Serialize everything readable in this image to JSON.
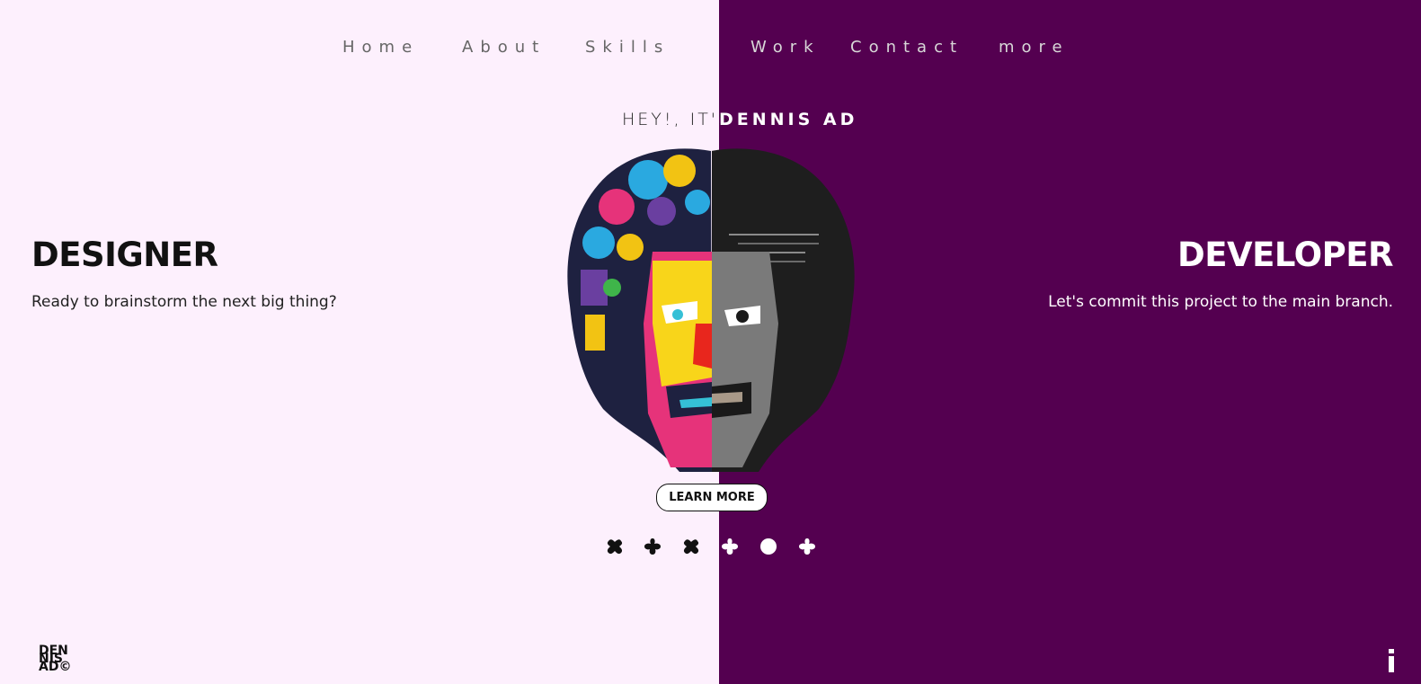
{
  "nav": {
    "items": [
      {
        "label": "Home",
        "theme": "light"
      },
      {
        "label": "About",
        "theme": "light"
      },
      {
        "label": "Skills",
        "theme": "light"
      },
      {
        "label": "Work",
        "theme": "dark"
      },
      {
        "label": "Contact",
        "theme": "dark"
      },
      {
        "label": "more",
        "theme": "dark"
      }
    ]
  },
  "hero": {
    "greeting": "HEY!, IT'S",
    "name": "DENNIS AD",
    "left_title": "DESIGNER",
    "left_subtitle": "Ready to brainstorm the next big thing?",
    "right_title": "DEVELOPER",
    "right_subtitle": "Let's commit this project to the main branch.",
    "cta_label": "LEARN MORE"
  },
  "logo": {
    "lines": [
      "DEN",
      "NIS",
      "AD©"
    ]
  },
  "colors": {
    "left_bg": "#fdf0fd",
    "right_bg": "#540050",
    "dark_text": "#111111",
    "light_text": "#ffffff"
  },
  "icons": {
    "info": "info-icon",
    "dots": [
      "blob-dot-icon",
      "blob-dot-icon",
      "blob-dot-icon",
      "blob-dot-icon",
      "circle-dot-icon",
      "blob-dot-icon"
    ]
  }
}
